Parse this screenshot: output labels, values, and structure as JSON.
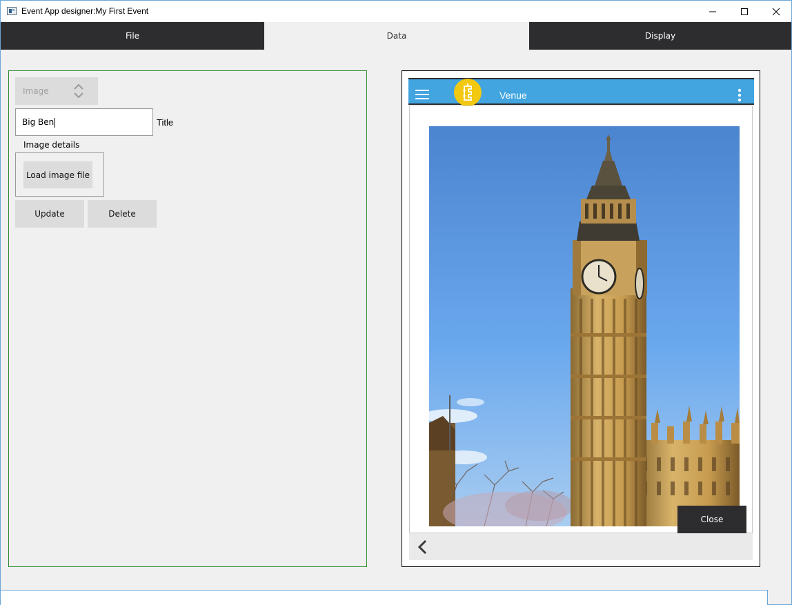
{
  "window": {
    "title": "Event App designer:My First Event",
    "icon": "app-window-icon",
    "controls": [
      "minimize-icon",
      "maximize-icon",
      "close-icon"
    ]
  },
  "tabs": [
    {
      "label": "File",
      "active": false
    },
    {
      "label": "Data",
      "active": true
    },
    {
      "label": "Display",
      "active": false
    }
  ],
  "editor": {
    "type_select": {
      "value": "Image",
      "icon": "updown-chevron-icon"
    },
    "title_input": {
      "value": "Big Ben"
    },
    "title_label": "Title",
    "details_label": "Image details",
    "load_button": "Load image file",
    "update_button": "Update",
    "delete_button": "Delete"
  },
  "preview": {
    "header_title": "Venue",
    "menu_icon": "hamburger-menu-icon",
    "logo": "event-app-logo-icon",
    "more_icon": "kebab-menu-icon",
    "image_subject": "Big Ben clock tower",
    "close_button": "Close",
    "back_icon": "chevron-left-icon"
  },
  "colors": {
    "dark": "#2d2d30",
    "header_blue": "#42a5e0",
    "logo_yellow": "#f2c811",
    "editor_border": "#2e8b2e",
    "window_border": "#6aa6d8"
  }
}
